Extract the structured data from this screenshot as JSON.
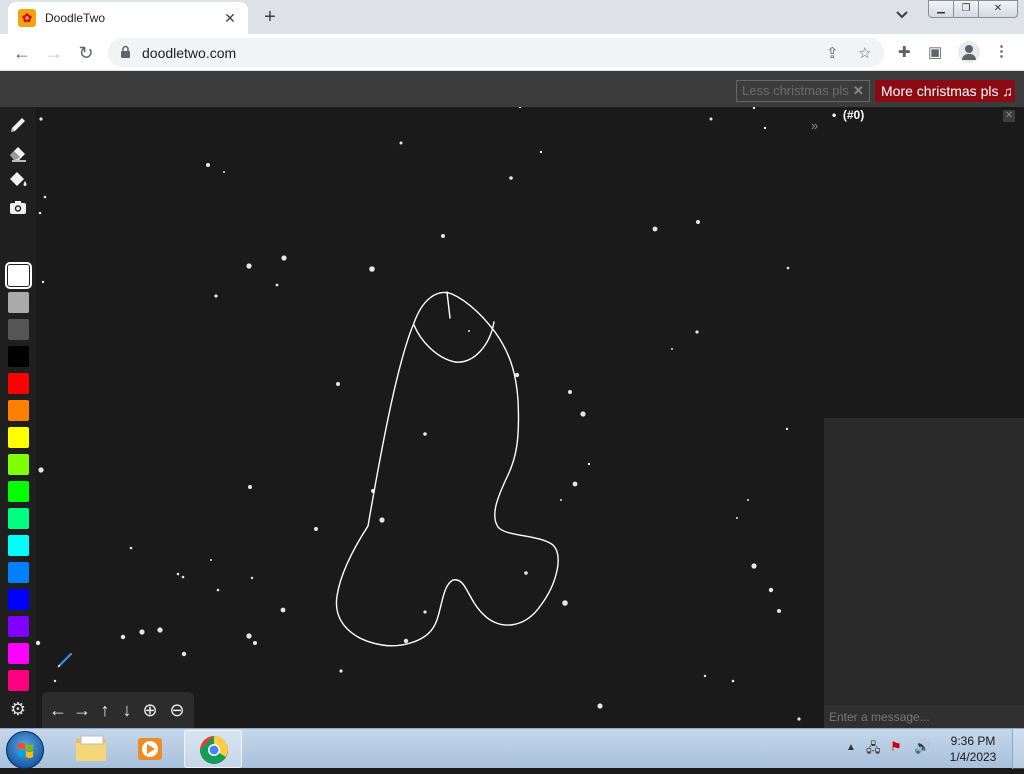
{
  "browser": {
    "tab_title": "DoodleTwo",
    "tab_close": "✕",
    "new_tab": "+",
    "url": "doodletwo.com",
    "window_controls": {
      "minimize": "▁",
      "maximize": "❐",
      "close": "✕"
    }
  },
  "site": {
    "less_christmas": "Less christmas pls",
    "more_christmas": "More christmas pls ♫",
    "less_close": "✕",
    "players_label": "(#0)",
    "collapse": "»",
    "panel_close": "✕",
    "chat_placeholder": "Enter a message..."
  },
  "tools": [
    "pencil-icon",
    "eraser-icon",
    "fill-bucket-icon",
    "camera-icon"
  ],
  "palette": [
    "#ffffff",
    "#aaaaaa",
    "#555555",
    "#000000",
    "#ff0000",
    "#ff7f00",
    "#ffff00",
    "#80ff00",
    "#00ff00",
    "#00ff80",
    "#00ffff",
    "#0080ff",
    "#0000ff",
    "#8000ff",
    "#ff00ff",
    "#ff0080"
  ],
  "selected_color": "#ffffff",
  "navpad": {
    "left": "←",
    "right": "→",
    "up": "↑",
    "down": "↓",
    "zoom_in": "⊕",
    "zoom_out": "⊖"
  },
  "taskbar": {
    "time": "9:36 PM",
    "date": "1/4/2023"
  }
}
